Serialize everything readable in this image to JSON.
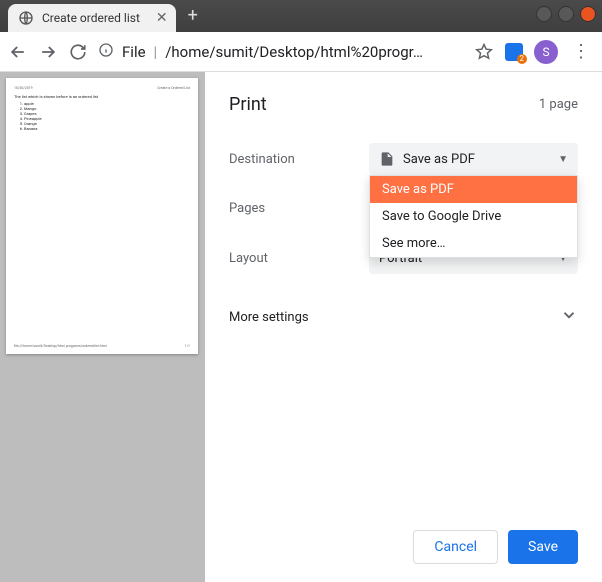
{
  "window": {
    "tab_title": "Create ordered list",
    "url_scheme": "File",
    "url_path": "/home/sumit/Desktop/html%20progr…",
    "avatar_initial": "S"
  },
  "preview": {
    "date": "10/30/2019",
    "doc_title": "Create a Ordered List",
    "list_caption": "The list which is shown before is an ordered list",
    "items": [
      "apple",
      "Mango",
      "Grapes",
      "Pineapple",
      "Orange",
      "Banana"
    ],
    "footer_path": "file:///home/sumit/Desktop/html programs/orderedlist.html",
    "footer_page": "1/1"
  },
  "print": {
    "title": "Print",
    "page_count": "1 page",
    "destination_label": "Destination",
    "destination_value": "Save as PDF",
    "destination_options": [
      "Save as PDF",
      "Save to Google Drive",
      "See more…"
    ],
    "pages_label": "Pages",
    "layout_label": "Layout",
    "layout_value": "Portrait",
    "more_settings": "More settings",
    "cancel": "Cancel",
    "save": "Save"
  }
}
